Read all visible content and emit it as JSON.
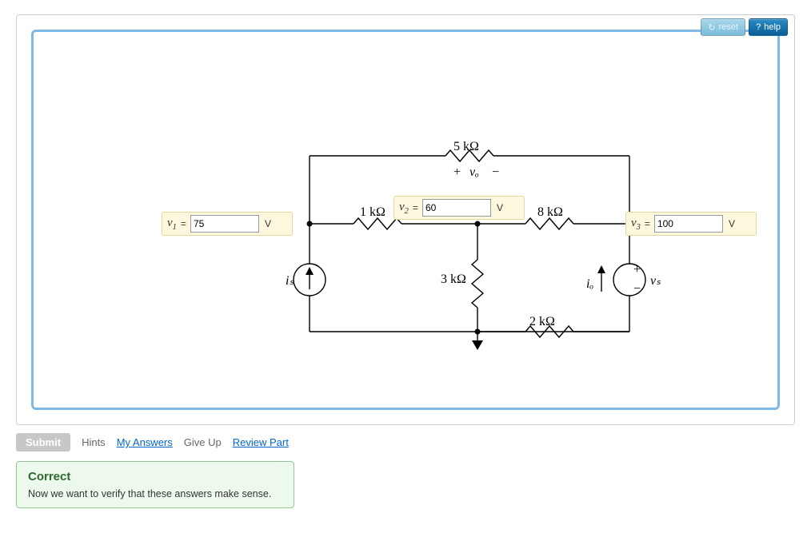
{
  "toolbar": {
    "reset_label": "reset",
    "help_label": "help"
  },
  "circuit": {
    "labels": {
      "r_top": "5 kΩ",
      "vo_plus": "+",
      "vo": "vₒ",
      "vo_minus": "−",
      "r1": "1 kΩ",
      "r8": "8 kΩ",
      "r3": "3 kΩ",
      "r2": "2 kΩ",
      "is": "iₛ",
      "io": "iₒ",
      "vs": "vₛ",
      "vs_plus": "+",
      "vs_minus": "−"
    },
    "nodes": {
      "v1": {
        "name": "v",
        "sub": "1",
        "value": "75",
        "unit": "V"
      },
      "v2": {
        "name": "v",
        "sub": "2",
        "value": "60",
        "unit": "V"
      },
      "v3": {
        "name": "v",
        "sub": "3",
        "value": "100",
        "unit": "V"
      }
    }
  },
  "actions": {
    "submit": "Submit",
    "hints": "Hints",
    "my_answers": "My Answers",
    "give_up": "Give Up",
    "review_part": "Review Part"
  },
  "feedback": {
    "title": "Correct",
    "body": "Now we want to verify that these answers make sense."
  }
}
